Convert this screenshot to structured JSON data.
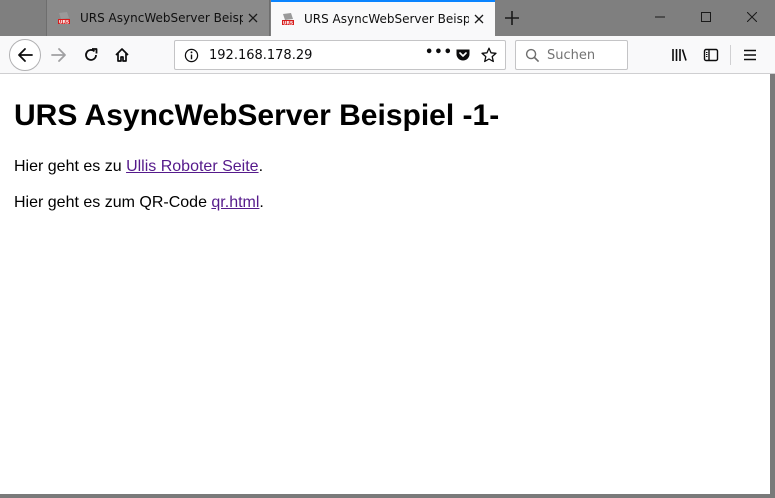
{
  "tabs": [
    {
      "title": "URS AsyncWebServer Beispiel"
    },
    {
      "title": "URS AsyncWebServer Beispiel"
    }
  ],
  "navbar": {
    "url": "192.168.178.29",
    "search_placeholder": "Suchen",
    "page_actions": "•••"
  },
  "page": {
    "heading": "URS AsyncWebServer Beispiel -1-",
    "line1_prefix": "Hier geht es zu ",
    "line1_link": "Ullis Roboter Seite",
    "line1_suffix": ".",
    "line2_prefix": "Hier geht es zum QR-Code ",
    "line2_link": "qr.html",
    "line2_suffix": "."
  },
  "colors": {
    "accent": "#0a84ff",
    "visited_link": "#551a8b"
  }
}
